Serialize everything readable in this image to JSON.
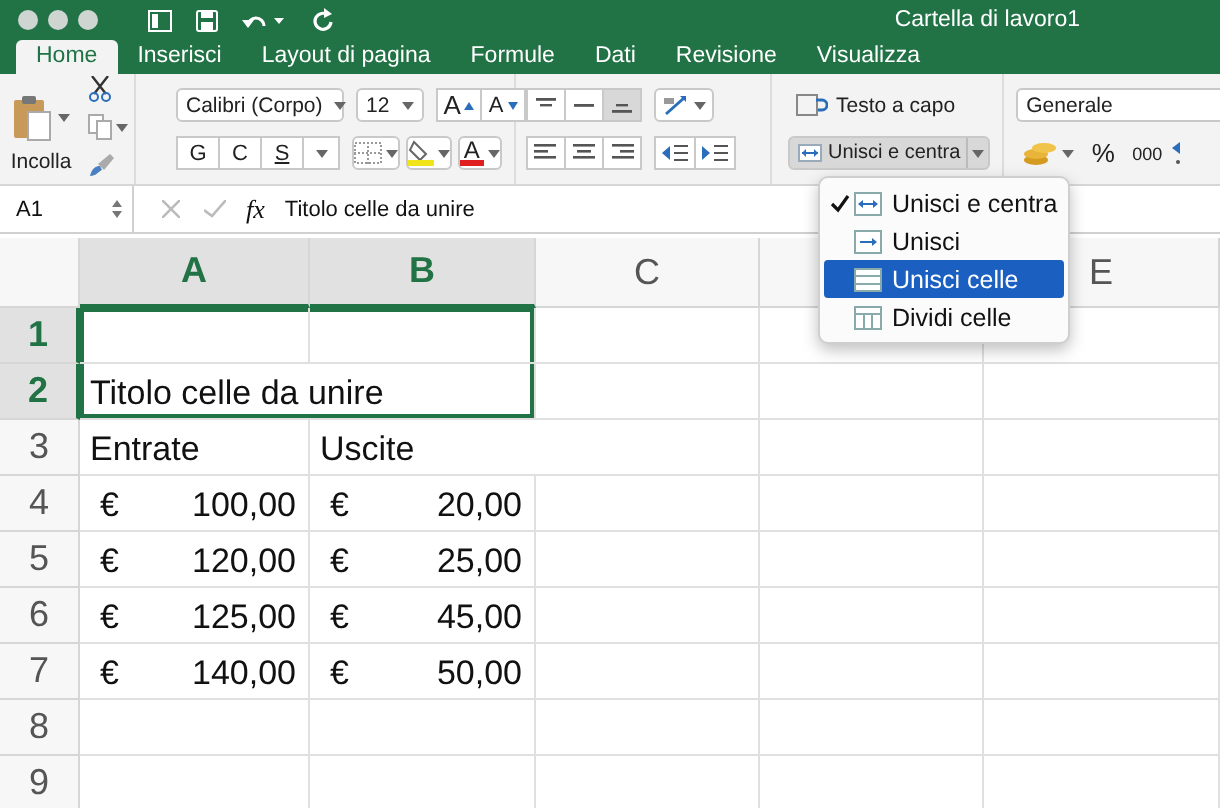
{
  "window": {
    "title": "Cartella di lavoro1"
  },
  "tabs": [
    {
      "label": "Home",
      "selected": true
    },
    {
      "label": "Inserisci",
      "selected": false
    },
    {
      "label": "Layout di pagina",
      "selected": false
    },
    {
      "label": "Formule",
      "selected": false
    },
    {
      "label": "Dati",
      "selected": false
    },
    {
      "label": "Revisione",
      "selected": false
    },
    {
      "label": "Visualizza",
      "selected": false
    }
  ],
  "ribbon": {
    "paste_label": "Incolla",
    "font": {
      "name": "Calibri (Corpo)",
      "size": "12",
      "grow": "A",
      "shrink": "A",
      "styles": [
        "G",
        "C",
        "S"
      ],
      "font_color": "A"
    },
    "vertical_align": [
      {
        "selected": false
      },
      {
        "selected": false
      },
      {
        "selected": true
      }
    ],
    "wrap_text": "Testo a capo",
    "merge_button": {
      "label": "Unisci e centra",
      "expanded": true
    },
    "number": {
      "format": "Generale",
      "percent": "%",
      "thousands": "000"
    }
  },
  "formula_bar": {
    "name_box": "A1",
    "function_label": "fx",
    "value": "Titolo celle da unire"
  },
  "sheet": {
    "columns": [
      {
        "label": "A",
        "selected": true
      },
      {
        "label": "B",
        "selected": true
      },
      {
        "label": "C",
        "selected": false
      },
      {
        "selected": false
      },
      {
        "label": "E",
        "selected": false
      }
    ],
    "rows": [
      {
        "label": "1",
        "selected": true,
        "cells": []
      },
      {
        "label": "2",
        "selected": true,
        "cells": [
          {
            "text": "Titolo celle da unire"
          }
        ]
      },
      {
        "label": "3",
        "selected": false,
        "cells": [
          {
            "text": "Entrate"
          },
          {
            "text": "Uscite"
          }
        ]
      },
      {
        "label": "4",
        "selected": false,
        "cells": [
          {
            "currency": "€",
            "amount": "100,00"
          },
          {
            "currency": "€",
            "amount": "20,00"
          }
        ]
      },
      {
        "label": "5",
        "selected": false,
        "cells": [
          {
            "currency": "€",
            "amount": "120,00"
          },
          {
            "currency": "€",
            "amount": "25,00"
          }
        ]
      },
      {
        "label": "6",
        "selected": false,
        "cells": [
          {
            "currency": "€",
            "amount": "125,00"
          },
          {
            "currency": "€",
            "amount": "45,00"
          }
        ]
      },
      {
        "label": "7",
        "selected": false,
        "cells": [
          {
            "currency": "€",
            "amount": "140,00"
          },
          {
            "currency": "€",
            "amount": "50,00"
          }
        ]
      },
      {
        "label": "8",
        "selected": false,
        "cells": []
      },
      {
        "label": "9",
        "selected": false,
        "cells": []
      }
    ]
  },
  "merge_menu": {
    "items": [
      {
        "kind": "center",
        "label": "Unisci e centra",
        "checked": true,
        "selected": false
      },
      {
        "kind": "across",
        "label": "Unisci",
        "checked": false,
        "selected": false
      },
      {
        "kind": "merge",
        "label": "Unisci celle",
        "checked": false,
        "selected": true
      },
      {
        "kind": "unmerge",
        "label": "Dividi celle",
        "checked": false,
        "selected": false
      }
    ]
  }
}
